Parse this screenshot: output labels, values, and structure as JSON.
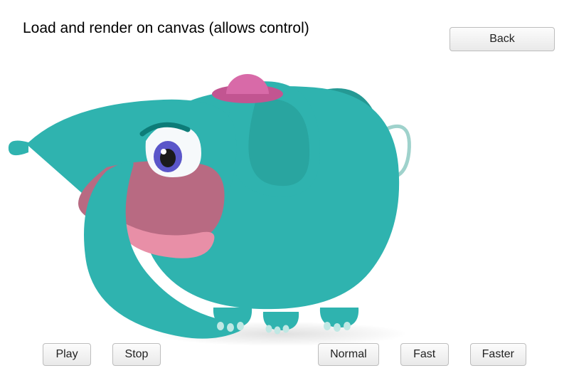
{
  "title": "Load and render on canvas (allows control)",
  "back_label": "Back",
  "controls": {
    "play": "Play",
    "stop": "Stop",
    "normal": "Normal",
    "fast": "Fast",
    "faster": "Faster"
  },
  "illustration": {
    "name": "elephant",
    "body_color": "#2fb3af",
    "body_color_dark": "#259994",
    "hat_color": "#d86aa8",
    "hat_band": "#c25591",
    "mouth_inner": "#b86a82",
    "tongue": "#e88fa7",
    "eye_iris": "#5a56c9",
    "eye_white": "#f6f9fb",
    "eye_pupil": "#1b1b1b",
    "tail_color": "#9fd2cc"
  }
}
